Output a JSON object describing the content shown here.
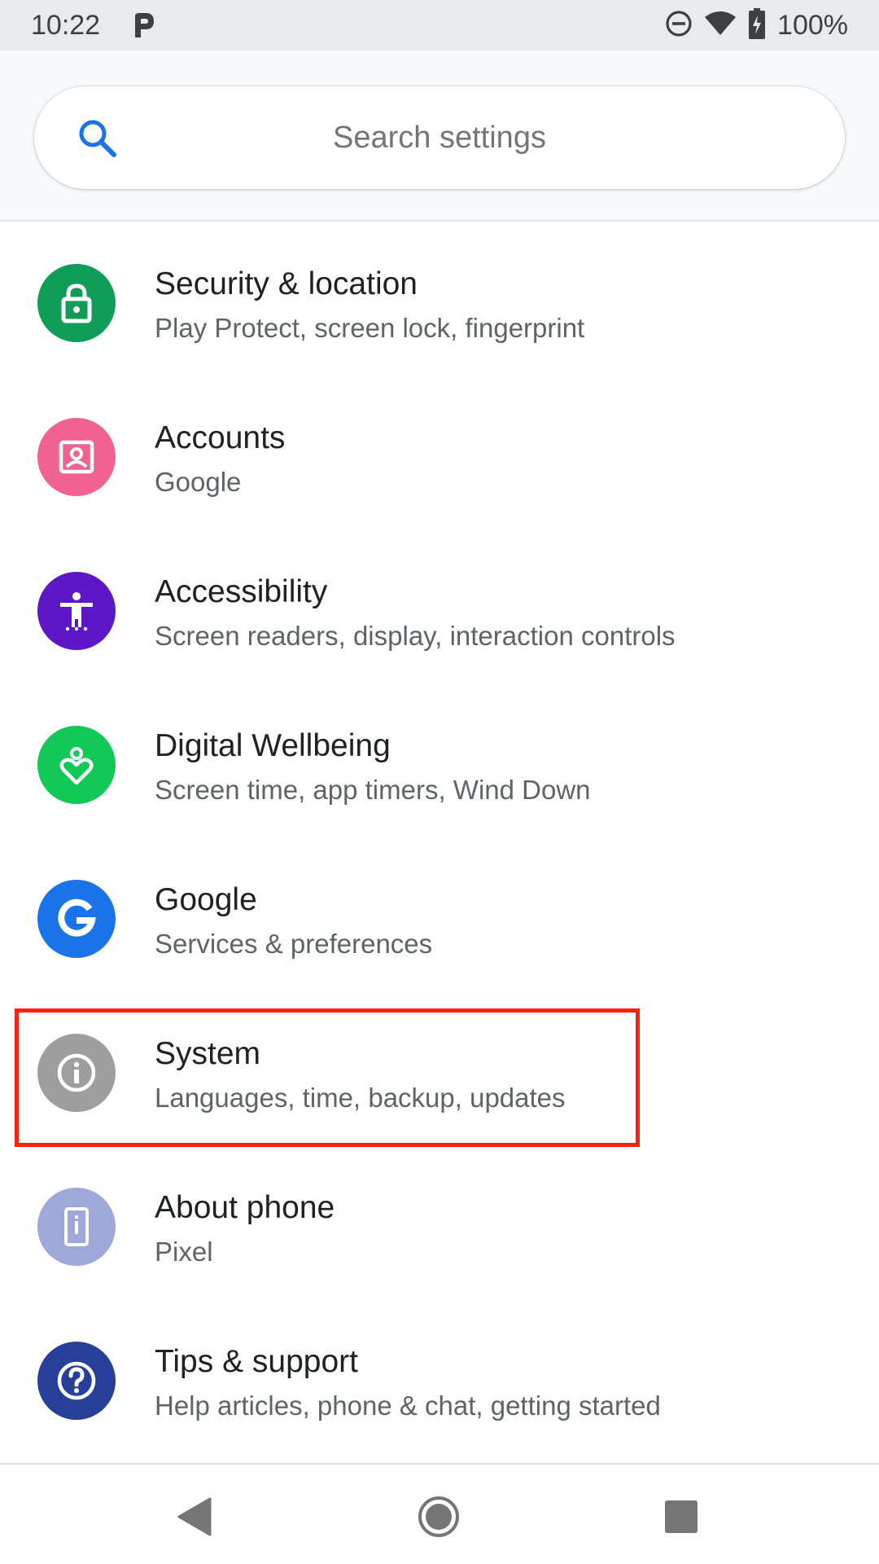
{
  "status_bar": {
    "time": "10:22",
    "battery_percent": "100%",
    "icons": [
      "parking-app-icon",
      "do-not-disturb-icon",
      "wifi-icon",
      "battery-charging-icon"
    ]
  },
  "search": {
    "placeholder": "Search settings",
    "icon": "search-icon"
  },
  "settings_list": [
    {
      "title": "Security & location",
      "subtitle": "Play Protect, screen lock, fingerprint",
      "icon": "lock-icon",
      "color": "#0f9d58"
    },
    {
      "title": "Accounts",
      "subtitle": "Google",
      "icon": "account-box-icon",
      "color": "#f06292"
    },
    {
      "title": "Accessibility",
      "subtitle": "Screen readers, display, interaction controls",
      "icon": "accessibility-icon",
      "color": "#5e17c7"
    },
    {
      "title": "Digital Wellbeing",
      "subtitle": "Screen time, app timers, Wind Down",
      "icon": "wellbeing-heart-icon",
      "color": "#12c857"
    },
    {
      "title": "Google",
      "subtitle": "Services & preferences",
      "icon": "google-g-icon",
      "color": "#1a73e8"
    },
    {
      "title": "System",
      "subtitle": "Languages, time, backup, updates",
      "icon": "info-icon",
      "color": "#9e9e9e"
    },
    {
      "title": "About phone",
      "subtitle": "Pixel",
      "icon": "phone-info-icon",
      "color": "#9fa8da"
    },
    {
      "title": "Tips & support",
      "subtitle": "Help articles, phone & chat, getting started",
      "icon": "help-icon",
      "color": "#283f9a"
    }
  ],
  "highlight": {
    "target": "System",
    "color": "#f5230f"
  },
  "nav_bar": {
    "buttons": [
      "back-icon",
      "home-icon",
      "recents-icon"
    ]
  }
}
